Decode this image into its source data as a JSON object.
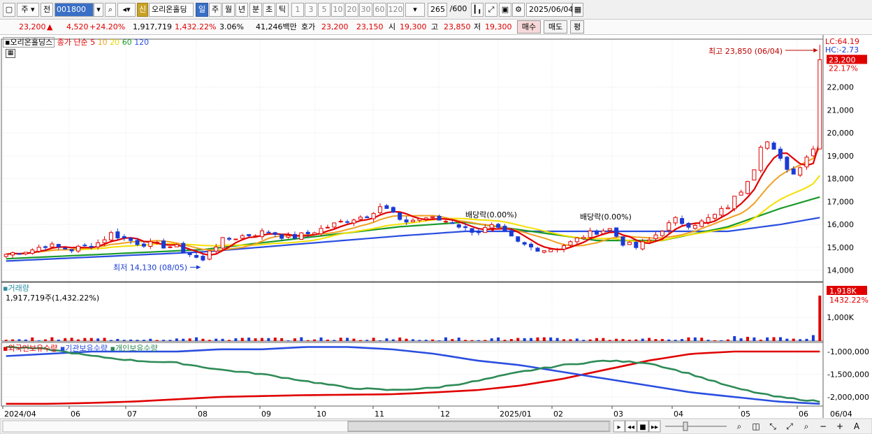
{
  "toolbar": {
    "market": "주",
    "prev": "전",
    "code": "001800",
    "credit": "신",
    "name": "오리온홀딩",
    "periods": [
      "일",
      "주",
      "월",
      "년",
      "분",
      "초",
      "틱"
    ],
    "minutes": [
      "1",
      "3",
      "5",
      "10",
      "20",
      "30",
      "60",
      "120"
    ],
    "count": "265",
    "count_total": "/600",
    "date": "2025/06/04"
  },
  "quote": {
    "price": "23,200",
    "up_icon": "triangle-up",
    "change": "4,520",
    "change_pct": "+24.20%",
    "volume": "1,917,719",
    "volume_pct": "1,432.22%",
    "turnover_pct": "3.06%",
    "amount": "41,246백만",
    "ask_label": "호가",
    "ask": "23,200",
    "bid": "23,150",
    "open_label": "시",
    "open": "19,300",
    "high_label": "고",
    "high": "23,850",
    "low_label": "저",
    "low": "19,300",
    "buy_label": "매수",
    "sell_label": "매도",
    "eval_label": "평"
  },
  "legend": {
    "name": "오리온홀딩스",
    "ma_label": "종가 단순",
    "ma_periods": [
      "5",
      "10",
      "20",
      "60",
      "120"
    ],
    "volume_label": "거래량",
    "volume_value": "1,917,719주(1,432.22%)",
    "holdings": [
      "외국인보유수량",
      "기관보유수량",
      "개인보유수량"
    ]
  },
  "annotations": {
    "high": "최고 23,850 (06/04)",
    "low": "최저 14,130 (08/05)",
    "dividend1": "배당락(0.00%)",
    "dividend2": "배당락(0.00%)",
    "lc": "LC:64.19",
    "hc": "HC:-2.73",
    "last_price": "23,200",
    "last_pct": "22.17%",
    "last_vol": "1,918K",
    "last_vol_pct": "1432.22%"
  },
  "colors": {
    "ma5": "#e00000",
    "ma10": "#f0a020",
    "ma20": "#f4e000",
    "ma60": "#1a9a2a",
    "ma120": "#2a4ee0",
    "up": "#e00000",
    "down": "#1a3bd6",
    "foreign": "#e00000",
    "institution": "#2a4ee0",
    "individual": "#2e8b57"
  },
  "chart_data": [
    {
      "type": "candlestick",
      "title": "오리온홀딩스",
      "x_ticks": [
        "2024/04",
        "06",
        "07",
        "08",
        "09",
        "10",
        "11",
        "12",
        "2025/01",
        "02",
        "03",
        "04",
        "05",
        "06",
        "06/04"
      ],
      "y_ticks": [
        14000,
        15000,
        16000,
        17000,
        18000,
        19000,
        20000,
        21000,
        22000,
        23000
      ],
      "ylim": [
        13500,
        24100
      ],
      "close_path": [
        [
          0,
          14700
        ],
        [
          4,
          14900
        ],
        [
          6,
          15100
        ],
        [
          8,
          15000
        ],
        [
          10,
          14900
        ],
        [
          14,
          15200
        ],
        [
          16,
          15600
        ],
        [
          18,
          15400
        ],
        [
          20,
          15200
        ],
        [
          23,
          15100
        ],
        [
          26,
          15000
        ],
        [
          28,
          14700
        ],
        [
          30,
          14400
        ],
        [
          31,
          14900
        ],
        [
          33,
          15300
        ],
        [
          36,
          15500
        ],
        [
          40,
          15700
        ],
        [
          43,
          15400
        ],
        [
          46,
          15600
        ],
        [
          49,
          15900
        ],
        [
          52,
          16200
        ],
        [
          55,
          16400
        ],
        [
          57,
          16800
        ],
        [
          59,
          16500
        ],
        [
          60,
          16100
        ],
        [
          62,
          16200
        ],
        [
          64,
          16300
        ],
        [
          66,
          16200
        ],
        [
          68,
          16100
        ],
        [
          70,
          15800
        ],
        [
          72,
          15700
        ],
        [
          74,
          15900
        ],
        [
          76,
          15600
        ],
        [
          78,
          15200
        ],
        [
          80,
          15000
        ],
        [
          82,
          14900
        ],
        [
          84,
          15000
        ],
        [
          86,
          15200
        ],
        [
          88,
          15500
        ],
        [
          90,
          15700
        ],
        [
          92,
          15800
        ],
        [
          94,
          15200
        ],
        [
          96,
          15000
        ],
        [
          98,
          15300
        ],
        [
          100,
          15800
        ],
        [
          102,
          16200
        ],
        [
          104,
          16000
        ],
        [
          106,
          16100
        ],
        [
          108,
          16400
        ],
        [
          110,
          16800
        ],
        [
          112,
          17500
        ],
        [
          114,
          18500
        ],
        [
          115,
          19500
        ],
        [
          116,
          19600
        ],
        [
          117,
          19200
        ],
        [
          118,
          18800
        ],
        [
          119,
          18500
        ],
        [
          120,
          18200
        ],
        [
          121,
          18600
        ],
        [
          122,
          19000
        ],
        [
          123,
          19300
        ],
        [
          124,
          23200
        ]
      ],
      "ma60_path": [
        [
          0,
          14500
        ],
        [
          30,
          14900
        ],
        [
          60,
          15900
        ],
        [
          70,
          16100
        ],
        [
          80,
          15700
        ],
        [
          90,
          15300
        ],
        [
          100,
          15300
        ],
        [
          110,
          15900
        ],
        [
          118,
          16700
        ],
        [
          124,
          17200
        ]
      ],
      "ma120_path": [
        [
          0,
          14400
        ],
        [
          30,
          14800
        ],
        [
          60,
          15500
        ],
        [
          70,
          15700
        ],
        [
          90,
          15700
        ],
        [
          110,
          15700
        ],
        [
          118,
          16000
        ],
        [
          124,
          16300
        ]
      ],
      "high": {
        "value": 23850,
        "date": "06/04"
      },
      "low": {
        "value": 14130,
        "date": "08/05"
      }
    },
    {
      "type": "bar",
      "title": "거래량",
      "y_ticks": [
        1000000
      ],
      "y_tick_labels": [
        "1,000K"
      ],
      "ylim": [
        0,
        2300000
      ],
      "last_value": 1917719,
      "typical_range": [
        30000,
        250000
      ]
    },
    {
      "type": "line",
      "title": "보유수량",
      "series": [
        {
          "name": "외국인보유수량",
          "values": [
            -2150000,
            -2150000,
            -2130000,
            -2100000,
            -2050000,
            -2000000,
            -1980000,
            -1960000,
            -1950000,
            -1940000,
            -1900000,
            -1850000,
            -1750000,
            -1600000,
            -1400000,
            -1200000,
            -1050000,
            -1000000,
            -1000000,
            -1000000
          ]
        },
        {
          "name": "기관보유수량",
          "values": [
            -1100000,
            -1050000,
            -1000000,
            -1000000,
            -1000000,
            -950000,
            -950000,
            -900000,
            -900000,
            -950000,
            -1050000,
            -1200000,
            -1300000,
            -1450000,
            -1600000,
            -1750000,
            -1900000,
            -2000000,
            -2100000,
            -2150000
          ]
        },
        {
          "name": "개인보유수량",
          "values": [
            -900000,
            -950000,
            -1100000,
            -1200000,
            -1250000,
            -1400000,
            -1500000,
            -1650000,
            -1800000,
            -1850000,
            -1800000,
            -1650000,
            -1450000,
            -1300000,
            -1200000,
            -1250000,
            -1500000,
            -1800000,
            -2000000,
            -2100000
          ]
        }
      ],
      "y_ticks": [
        -1000000,
        -1500000,
        -2000000
      ],
      "y_tick_labels": [
        "-1,000,000",
        "-1,500,000",
        "-2,000,000"
      ],
      "ylim": [
        -2200000,
        -800000
      ]
    }
  ]
}
